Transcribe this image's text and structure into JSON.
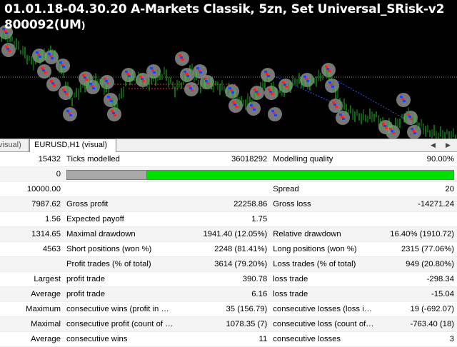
{
  "chart": {
    "title_line1": "01.01.18-04.30.20 A-Markets Classik, 5zn, Set Universal_SRisk-v2",
    "title_line2_main": "800092(UM",
    "title_line2_tail": ")"
  },
  "tabs": {
    "inactive_label": "visual)",
    "active_label": "EURUSD,H1 (visual)",
    "left_arrow": "◀",
    "right_arrow": "▶"
  },
  "quality_bar": {
    "fill_fraction": 0.205
  },
  "colors": {
    "bar_green": "#00e000",
    "bar_grey": "#a8a8a8"
  },
  "rows": [
    [
      "15432",
      "Ticks modelled",
      "36018292",
      "Modelling quality",
      "90.00%"
    ],
    [
      "0",
      "",
      "",
      "",
      ""
    ],
    [
      "10000.00",
      "",
      "",
      "Spread",
      "20"
    ],
    [
      "7987.62",
      "Gross profit",
      "22258.86",
      "Gross loss",
      "-14271.24"
    ],
    [
      "1.56",
      "Expected payoff",
      "1.75",
      "",
      ""
    ],
    [
      "1314.65",
      "Maximal drawdown",
      "1941.40 (12.05%)",
      "Relative drawdown",
      "16.40% (1910.72)"
    ],
    [
      "4563",
      "Short positions (won %)",
      "2248 (81.41%)",
      "Long positions (won %)",
      "2315 (77.06%)"
    ],
    [
      "",
      "Profit trades (% of total)",
      "3614 (79.20%)",
      "Loss trades (% of total)",
      "949 (20.80%)"
    ],
    [
      "Largest",
      "profit trade",
      "390.78",
      "loss trade",
      "-298.34"
    ],
    [
      "Average",
      "profit trade",
      "6.16",
      "loss trade",
      "-15.04"
    ],
    [
      "Maximum",
      "consecutive wins (profit in money)",
      "35 (156.79)",
      "consecutive losses (loss in money)",
      "19 (-692.07)"
    ],
    [
      "Maximal",
      "consecutive profit (count of wins)",
      "1078.35 (7)",
      "consecutive loss (count of losses)",
      "-763.40 (18)"
    ],
    [
      "Average",
      "consecutive wins",
      "11",
      "consecutive losses",
      "3"
    ]
  ]
}
